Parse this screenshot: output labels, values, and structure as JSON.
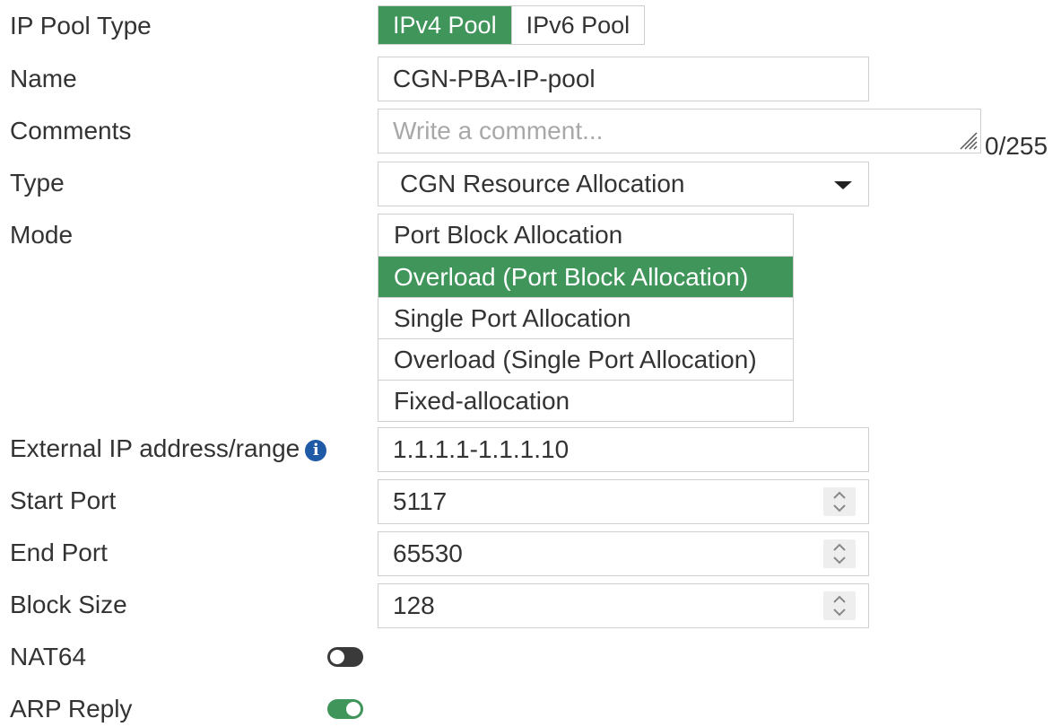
{
  "form": {
    "ip_pool_type": {
      "label": "IP Pool Type",
      "options": [
        "IPv4 Pool",
        "IPv6 Pool"
      ],
      "selected": "IPv4 Pool"
    },
    "name": {
      "label": "Name",
      "value": "CGN-PBA-IP-pool"
    },
    "comments": {
      "label": "Comments",
      "value": "",
      "placeholder": "Write a comment...",
      "char_count": "0/255"
    },
    "type": {
      "label": "Type",
      "selected": "CGN Resource Allocation"
    },
    "mode": {
      "label": "Mode",
      "options": [
        "Port Block Allocation",
        "Overload (Port Block Allocation)",
        "Single Port Allocation",
        "Overload (Single Port Allocation)",
        "Fixed-allocation"
      ],
      "selected": "Overload (Port Block Allocation)"
    },
    "external_ip": {
      "label": "External IP address/range",
      "value": "1.1.1.1-1.1.1.10",
      "icon": "info-icon"
    },
    "start_port": {
      "label": "Start Port",
      "value": "5117"
    },
    "end_port": {
      "label": "End Port",
      "value": "65530"
    },
    "block_size": {
      "label": "Block Size",
      "value": "128"
    },
    "nat64": {
      "label": "NAT64",
      "enabled": false
    },
    "arp_reply": {
      "label": "ARP Reply",
      "enabled": true
    }
  },
  "colors": {
    "accent": "#40955a",
    "border": "#cfcfcf",
    "text": "#333333",
    "placeholder": "#a8a8a8",
    "info": "#1f5aa6",
    "toggle_off": "#3a3a3a"
  }
}
